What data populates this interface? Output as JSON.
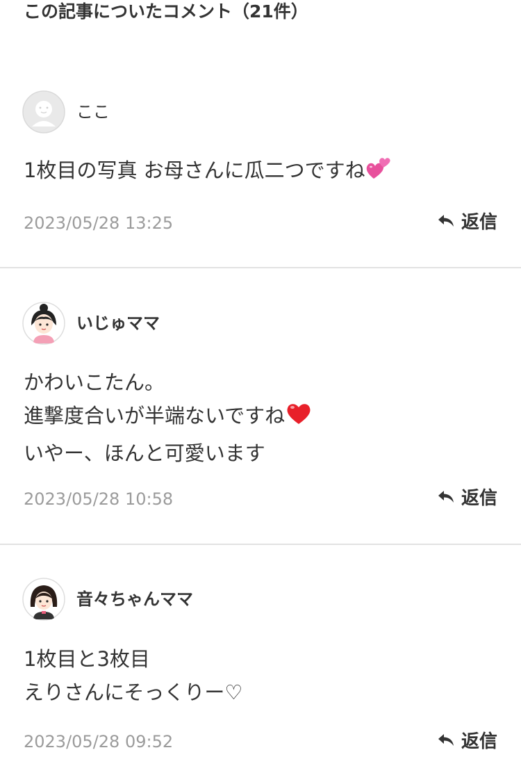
{
  "section": {
    "title": "この記事についたコメント（21件）"
  },
  "comments": [
    {
      "username": "ここ",
      "avatar_icon": "default-face-icon",
      "lines": [
        "1枚目の写真 お母さんに瓜二つですね"
      ],
      "emoji": "two-hearts-emoji",
      "timestamp": "2023/05/28 13:25",
      "reply_label": "返信"
    },
    {
      "username": "いじゅママ",
      "avatar_icon": "girl-bun-avatar-icon",
      "lines": [
        "かわいこたん。",
        "進撃度合いが半端ないですね",
        "いやー、ほんと可愛います"
      ],
      "emoji": "red-heart-emoji",
      "timestamp": "2023/05/28 10:58",
      "reply_label": "返信"
    },
    {
      "username": "音々ちゃんママ",
      "avatar_icon": "girl-bob-avatar-icon",
      "lines": [
        "1枚目と3枚目",
        "えりさんにそっくりー♡"
      ],
      "timestamp": "2023/05/28 09:52",
      "reply_label": "返信"
    }
  ],
  "colors": {
    "text": "#333333",
    "muted": "#9b9b9b",
    "divider": "#e2e2e2",
    "heart": "#e8202a",
    "pink_heart": "#f06eb4"
  }
}
